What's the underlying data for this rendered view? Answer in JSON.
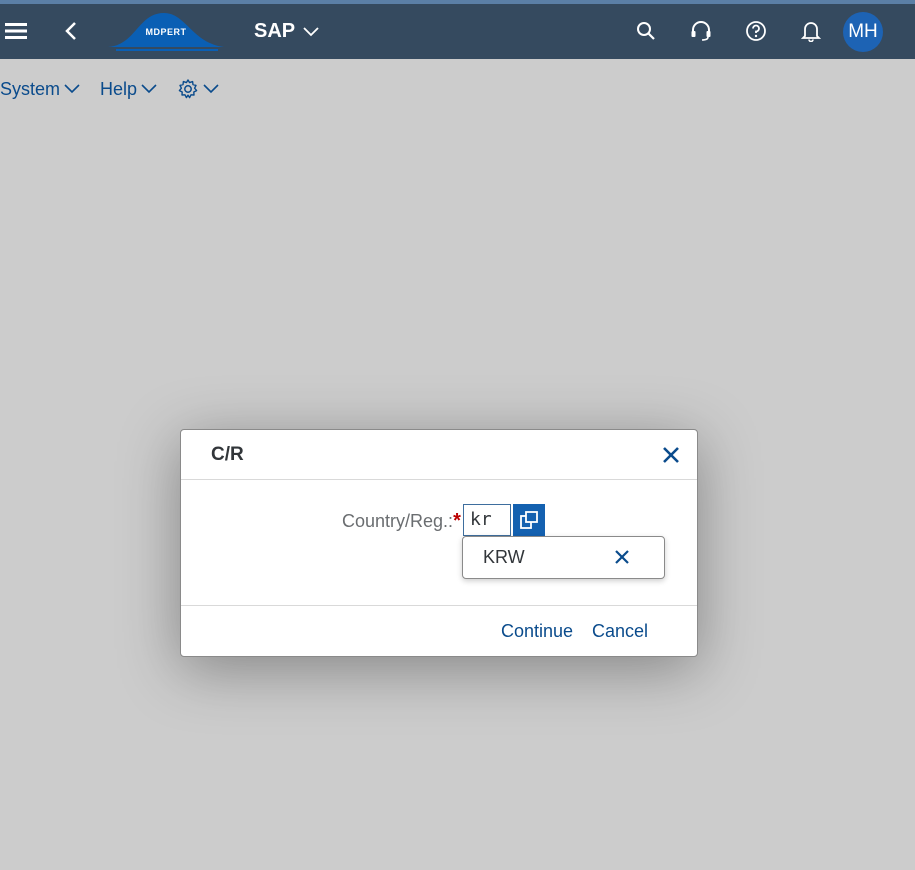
{
  "shell": {
    "logo_text": "MDPERT",
    "title": "SAP",
    "avatar_initials": "MH",
    "colors": {
      "shell_bg": "#354a5f",
      "avatar_bg": "#1d63b4",
      "accent": "#0a4b8c"
    }
  },
  "icons": {
    "menu": "hamburger-icon",
    "back": "back-arrow-icon",
    "search": "search-icon",
    "support": "headset-icon",
    "help": "help-icon",
    "notifications": "bell-icon",
    "settings": "gear-icon"
  },
  "menubar": {
    "items": [
      {
        "label": "System"
      },
      {
        "label": "Help"
      }
    ]
  },
  "dialog": {
    "title": "C/R",
    "field_label": "Country/Reg.:",
    "required_marker": "*",
    "input_value": "kr",
    "suggestions": [
      "KRW"
    ],
    "continue_label": "Continue",
    "cancel_label": "Cancel"
  }
}
